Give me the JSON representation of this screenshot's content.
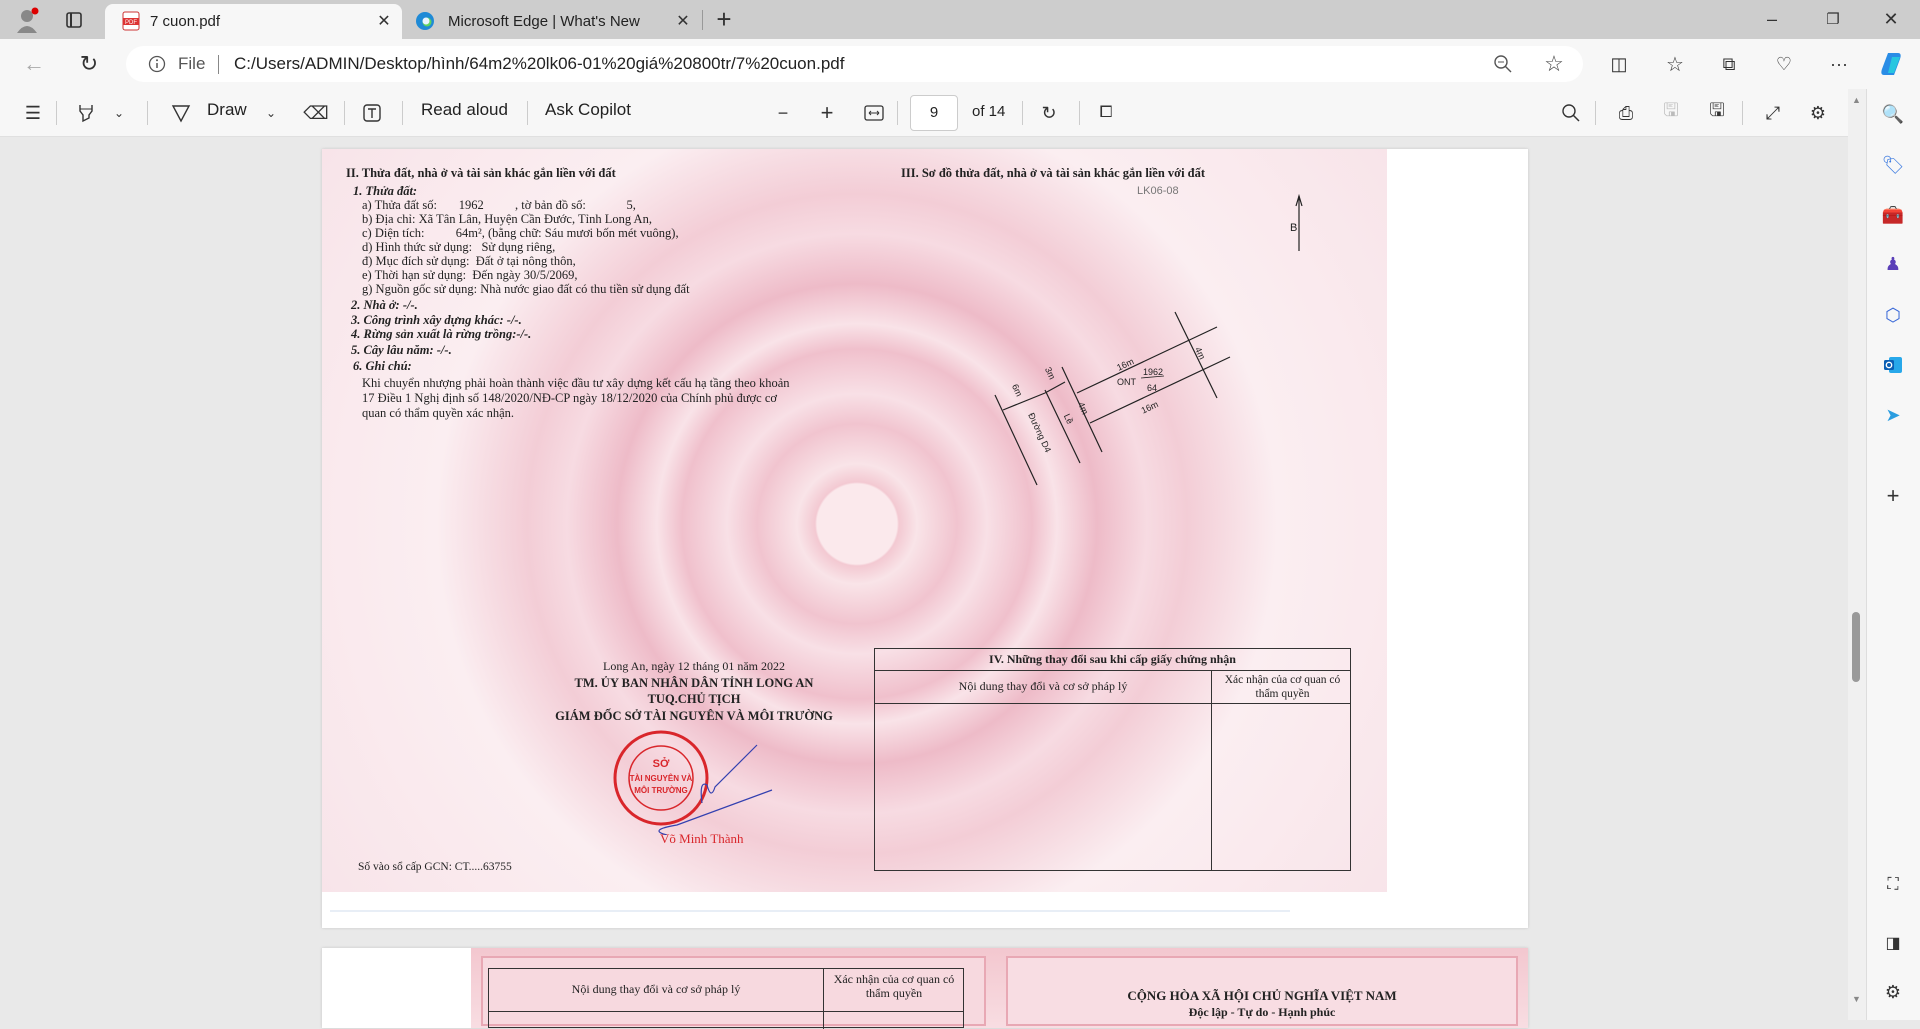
{
  "browser": {
    "tabs": [
      {
        "title": "7 cuon.pdf",
        "icon": "pdf-icon"
      },
      {
        "title": "Microsoft Edge | What's New",
        "icon": "edge-icon"
      }
    ],
    "address": {
      "scheme": "File",
      "url": "C:/Users/ADMIN/Desktop/hình/64m2%20lk06-01%20giá%20800tr/7%20cuon.pdf"
    }
  },
  "pdf_toolbar": {
    "draw": "Draw",
    "read_aloud": "Read aloud",
    "ask_copilot": "Ask Copilot",
    "page_number": "9",
    "page_total": "of 14"
  },
  "doc": {
    "sec2_title": "II. Thửa đất, nhà ở và tài sản khác gắn liền với đất",
    "lines": [
      "1. Thửa đất:",
      "a) Thửa đất số:       1962          , tờ bản đồ số:             5,",
      "b) Địa chỉ:  Xã Tân Lân, Huyện Cần Đước, Tỉnh Long An,",
      "c) Diện tích:          64m², (bằng chữ: Sáu mươi bốn mét vuông),",
      "d) Hình thức sử dụng:   Sử dụng riêng,",
      "đ) Mục đích sử dụng:  Đất ở tại nông thôn,",
      "e) Thời hạn sử dụng:  Đến ngày 30/5/2069,",
      "g) Nguồn gốc sử dụng: Nhà nước giao đất có thu tiền sử dụng đất",
      "2. Nhà ở:  -/-.",
      "3. Công trình xây dựng khác: -/-.",
      "4. Rừng sản xuất là rừng trồng:-/-.",
      "5. Cây lâu năm:  -/-.",
      "6. Ghi chú:",
      "Khi chuyển nhượng phải hoàn thành việc đầu tư xây dựng kết cấu hạ tầng theo khoản",
      "17 Điều 1 Nghị định số 148/2020/NĐ-CP ngày 18/12/2020 của Chính phủ được cơ",
      "quan có thẩm quyền xác nhận."
    ],
    "sec3_title": "III. Sơ đồ thửa đất, nhà ở và tài sản khác gắn liền với đất",
    "lot_code": "LK06-08",
    "diagram": {
      "north": "B",
      "len_top": "16m",
      "len_bottom": "16m",
      "width_right": "4m",
      "width_left": "4m",
      "lot_no": "1962",
      "use": "ONT",
      "area": "64",
      "road_width": "6m",
      "sidewalk_width": "3m",
      "road": "Đường D4",
      "sidewalk": "Lề"
    },
    "sign": {
      "date": "Long An, ngày  12  tháng  01  năm 2022",
      "org": "TM. ỦY BAN NHÂN DÂN TỈNH LONG AN",
      "role": "TUQ.CHỦ TỊCH",
      "title": "GIÁM ĐỐC SỞ TÀI NGUYÊN VÀ MÔI TRƯỜNG",
      "name": "Võ Minh Thành",
      "stamp": "SỞ TÀI NGUYÊN VÀ MÔI TRƯỜNG - CỘNG HÒA X.H.C.N VIỆT NAM - TỈNH LONG AN"
    },
    "reg_no": "Số vào sổ cấp GCN: CT.....63755",
    "sec4_title": "IV. Những thay đổi sau khi cấp giấy chứng nhận",
    "col1": "Nội dung thay đổi và cơ sở pháp lý",
    "col2": "Xác nhận của cơ quan có thẩm quyền"
  },
  "page2": {
    "col1": "Nội dung thay đổi và cơ sở pháp lý",
    "col2": "Xác nhận của cơ quan có thẩm quyền",
    "country": "CỘNG HÒA XÃ HỘI CHỦ NGHĨA VIỆT NAM",
    "motto": "Độc lập - Tự do - Hạnh phúc"
  },
  "colors": {
    "cert_pink": "#f3cdd6",
    "stamp_red": "#d9262b",
    "ink_blue": "#3340b0"
  }
}
